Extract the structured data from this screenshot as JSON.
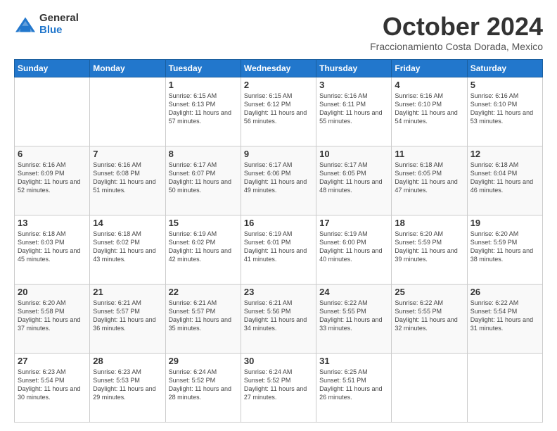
{
  "logo": {
    "general": "General",
    "blue": "Blue"
  },
  "header": {
    "month": "October 2024",
    "location": "Fraccionamiento Costa Dorada, Mexico"
  },
  "days_of_week": [
    "Sunday",
    "Monday",
    "Tuesday",
    "Wednesday",
    "Thursday",
    "Friday",
    "Saturday"
  ],
  "weeks": [
    [
      {
        "day": "",
        "info": ""
      },
      {
        "day": "",
        "info": ""
      },
      {
        "day": "1",
        "info": "Sunrise: 6:15 AM\nSunset: 6:13 PM\nDaylight: 11 hours and 57 minutes."
      },
      {
        "day": "2",
        "info": "Sunrise: 6:15 AM\nSunset: 6:12 PM\nDaylight: 11 hours and 56 minutes."
      },
      {
        "day": "3",
        "info": "Sunrise: 6:16 AM\nSunset: 6:11 PM\nDaylight: 11 hours and 55 minutes."
      },
      {
        "day": "4",
        "info": "Sunrise: 6:16 AM\nSunset: 6:10 PM\nDaylight: 11 hours and 54 minutes."
      },
      {
        "day": "5",
        "info": "Sunrise: 6:16 AM\nSunset: 6:10 PM\nDaylight: 11 hours and 53 minutes."
      }
    ],
    [
      {
        "day": "6",
        "info": "Sunrise: 6:16 AM\nSunset: 6:09 PM\nDaylight: 11 hours and 52 minutes."
      },
      {
        "day": "7",
        "info": "Sunrise: 6:16 AM\nSunset: 6:08 PM\nDaylight: 11 hours and 51 minutes."
      },
      {
        "day": "8",
        "info": "Sunrise: 6:17 AM\nSunset: 6:07 PM\nDaylight: 11 hours and 50 minutes."
      },
      {
        "day": "9",
        "info": "Sunrise: 6:17 AM\nSunset: 6:06 PM\nDaylight: 11 hours and 49 minutes."
      },
      {
        "day": "10",
        "info": "Sunrise: 6:17 AM\nSunset: 6:05 PM\nDaylight: 11 hours and 48 minutes."
      },
      {
        "day": "11",
        "info": "Sunrise: 6:18 AM\nSunset: 6:05 PM\nDaylight: 11 hours and 47 minutes."
      },
      {
        "day": "12",
        "info": "Sunrise: 6:18 AM\nSunset: 6:04 PM\nDaylight: 11 hours and 46 minutes."
      }
    ],
    [
      {
        "day": "13",
        "info": "Sunrise: 6:18 AM\nSunset: 6:03 PM\nDaylight: 11 hours and 45 minutes."
      },
      {
        "day": "14",
        "info": "Sunrise: 6:18 AM\nSunset: 6:02 PM\nDaylight: 11 hours and 43 minutes."
      },
      {
        "day": "15",
        "info": "Sunrise: 6:19 AM\nSunset: 6:02 PM\nDaylight: 11 hours and 42 minutes."
      },
      {
        "day": "16",
        "info": "Sunrise: 6:19 AM\nSunset: 6:01 PM\nDaylight: 11 hours and 41 minutes."
      },
      {
        "day": "17",
        "info": "Sunrise: 6:19 AM\nSunset: 6:00 PM\nDaylight: 11 hours and 40 minutes."
      },
      {
        "day": "18",
        "info": "Sunrise: 6:20 AM\nSunset: 5:59 PM\nDaylight: 11 hours and 39 minutes."
      },
      {
        "day": "19",
        "info": "Sunrise: 6:20 AM\nSunset: 5:59 PM\nDaylight: 11 hours and 38 minutes."
      }
    ],
    [
      {
        "day": "20",
        "info": "Sunrise: 6:20 AM\nSunset: 5:58 PM\nDaylight: 11 hours and 37 minutes."
      },
      {
        "day": "21",
        "info": "Sunrise: 6:21 AM\nSunset: 5:57 PM\nDaylight: 11 hours and 36 minutes."
      },
      {
        "day": "22",
        "info": "Sunrise: 6:21 AM\nSunset: 5:57 PM\nDaylight: 11 hours and 35 minutes."
      },
      {
        "day": "23",
        "info": "Sunrise: 6:21 AM\nSunset: 5:56 PM\nDaylight: 11 hours and 34 minutes."
      },
      {
        "day": "24",
        "info": "Sunrise: 6:22 AM\nSunset: 5:55 PM\nDaylight: 11 hours and 33 minutes."
      },
      {
        "day": "25",
        "info": "Sunrise: 6:22 AM\nSunset: 5:55 PM\nDaylight: 11 hours and 32 minutes."
      },
      {
        "day": "26",
        "info": "Sunrise: 6:22 AM\nSunset: 5:54 PM\nDaylight: 11 hours and 31 minutes."
      }
    ],
    [
      {
        "day": "27",
        "info": "Sunrise: 6:23 AM\nSunset: 5:54 PM\nDaylight: 11 hours and 30 minutes."
      },
      {
        "day": "28",
        "info": "Sunrise: 6:23 AM\nSunset: 5:53 PM\nDaylight: 11 hours and 29 minutes."
      },
      {
        "day": "29",
        "info": "Sunrise: 6:24 AM\nSunset: 5:52 PM\nDaylight: 11 hours and 28 minutes."
      },
      {
        "day": "30",
        "info": "Sunrise: 6:24 AM\nSunset: 5:52 PM\nDaylight: 11 hours and 27 minutes."
      },
      {
        "day": "31",
        "info": "Sunrise: 6:25 AM\nSunset: 5:51 PM\nDaylight: 11 hours and 26 minutes."
      },
      {
        "day": "",
        "info": ""
      },
      {
        "day": "",
        "info": ""
      }
    ]
  ]
}
